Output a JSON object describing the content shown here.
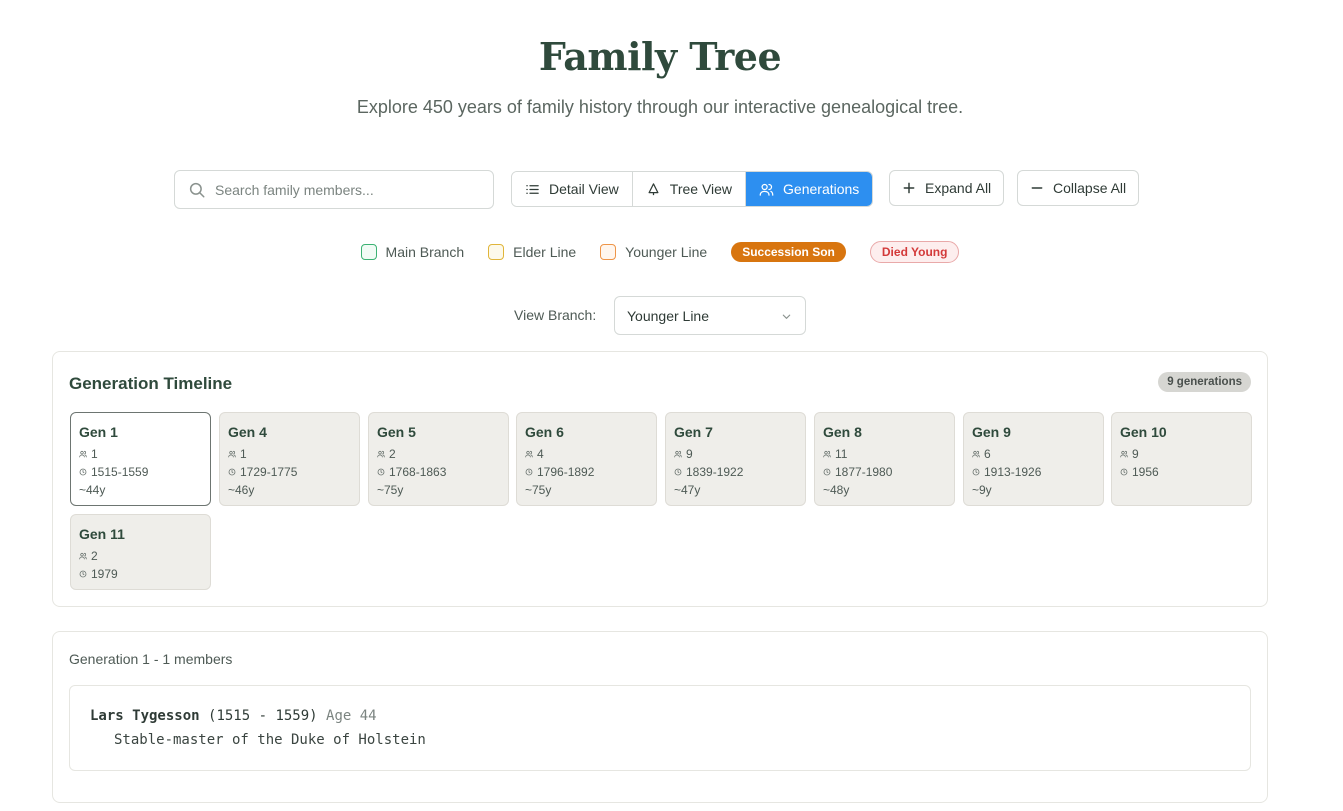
{
  "page": {
    "title": "Family Tree",
    "subtitle": "Explore 450 years of family history through our interactive genealogical tree."
  },
  "search": {
    "placeholder": "Search family members..."
  },
  "views": {
    "detail": "Detail View",
    "tree": "Tree View",
    "generations": "Generations",
    "active": "generations"
  },
  "actions": {
    "expand_all": "Expand All",
    "collapse_all": "Collapse All"
  },
  "legend": {
    "main_branch": {
      "label": "Main Branch",
      "color": "#3bb273"
    },
    "elder_line": {
      "label": "Elder Line",
      "color": "#e0b53a"
    },
    "younger_line": {
      "label": "Younger Line",
      "color": "#ee9548"
    },
    "succession_son": "Succession Son",
    "died_young": "Died Young"
  },
  "branch_filter": {
    "label": "View Branch:",
    "selected": "Younger Line"
  },
  "timeline": {
    "title": "Generation Timeline",
    "badge": "9 generations",
    "generations": [
      {
        "label": "Gen 1",
        "members": "1",
        "years": "1515-1559",
        "span": "~44y",
        "selected": true
      },
      {
        "label": "Gen 4",
        "members": "1",
        "years": "1729-1775",
        "span": "~46y"
      },
      {
        "label": "Gen 5",
        "members": "2",
        "years": "1768-1863",
        "span": "~75y"
      },
      {
        "label": "Gen 6",
        "members": "4",
        "years": "1796-1892",
        "span": "~75y"
      },
      {
        "label": "Gen 7",
        "members": "9",
        "years": "1839-1922",
        "span": "~47y"
      },
      {
        "label": "Gen 8",
        "members": "11",
        "years": "1877-1980",
        "span": "~48y"
      },
      {
        "label": "Gen 9",
        "members": "6",
        "years": "1913-1926",
        "span": "~9y"
      },
      {
        "label": "Gen 10",
        "members": "9",
        "years": "1956",
        "span": ""
      },
      {
        "label": "Gen 11",
        "members": "2",
        "years": "1979",
        "span": ""
      }
    ]
  },
  "selected_generation": {
    "title": "Generation 1 - 1 members",
    "members": [
      {
        "name": "Lars Tygesson",
        "dates": "(1515 - 1559)",
        "age": "Age 44",
        "occupation": "Stable-master of the Duke of Holstein"
      }
    ]
  }
}
